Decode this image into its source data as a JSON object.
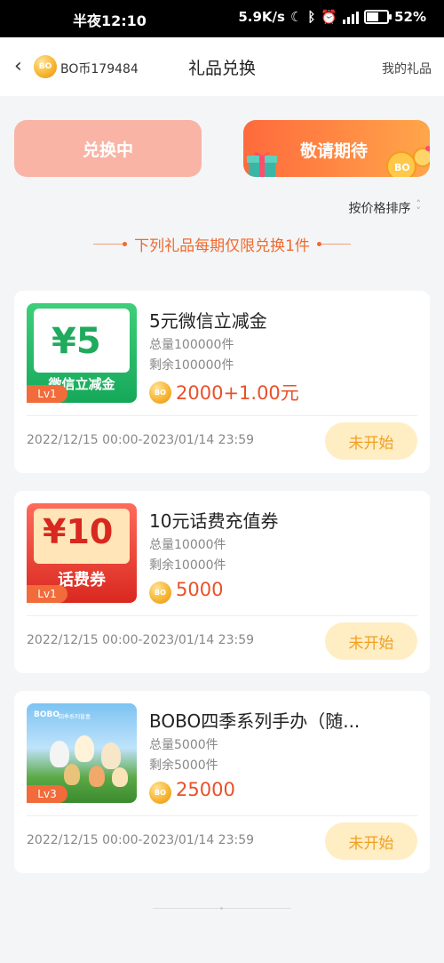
{
  "status_bar": {
    "time": "半夜12:10",
    "network_speed": "5.9K/s",
    "battery": "52%"
  },
  "header": {
    "back_icon": "chevron-left-icon",
    "coin_label": "BO",
    "balance": "BO币179484",
    "title": "礼品兑换",
    "my_gifts": "我的礼品"
  },
  "tabs": {
    "exchanging": "兑换中",
    "coming_soon": "敬请期待"
  },
  "sort_label": "按价格排序",
  "notice": "下列礼品每期仅限兑换1件",
  "items": [
    {
      "title": "5元微信立减金",
      "total": "总量100000件",
      "remaining": "剩余100000件",
      "price": "2000+1.00元",
      "level": "Lv1",
      "dates": "2022/12/15 00:00-2023/01/14 23:59",
      "status": "未开始",
      "thumb_big": "¥5",
      "thumb_sub": "微信立减金"
    },
    {
      "title": "10元话费充值券",
      "total": "总量10000件",
      "remaining": "剩余10000件",
      "price": "5000",
      "level": "Lv1",
      "dates": "2022/12/15 00:00-2023/01/14 23:59",
      "status": "未开始",
      "thumb_big": "¥10",
      "thumb_sub": "话费券"
    },
    {
      "title": "BOBO四季系列手办（随...",
      "total": "总量5000件",
      "remaining": "剩余5000件",
      "price": "25000",
      "level": "Lv3",
      "dates": "2022/12/15 00:00-2023/01/14 23:59",
      "status": "未开始",
      "thumb_big": "BOBO",
      "thumb_sub": "四季系列盲盒"
    }
  ],
  "colors": {
    "accent": "#f06a2e",
    "price": "#e8512a",
    "status_bg": "#ffedc4",
    "status_text": "#f0a020"
  }
}
